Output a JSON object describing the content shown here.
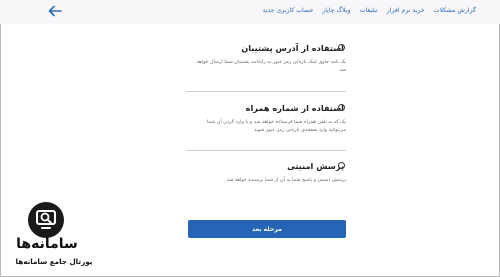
{
  "nav": {
    "items": [
      {
        "label": "گزارش مشکلات"
      },
      {
        "label": "خرید نرم افزار"
      },
      {
        "label": "تبلیغات"
      },
      {
        "label": "وبلاگ چاپار"
      },
      {
        "label": "حساب کاربری جدید"
      }
    ],
    "back_icon": "arrow-left-icon"
  },
  "options": [
    {
      "title": "استفاده از آدرس پشتیبان",
      "description": "یک نامه حاوی لینک بازیابی رمز عبور به رایانامه پشتیبان شما ارسال خواهد شد"
    },
    {
      "title": "استفاده از شماره همراه",
      "description": "یک کد به تلفن همراه شما فرستاده خواهد شد و با وارد کردن آن شما می‌توانید وارد صفحه‌ی بازیابی رمز عبور شوید"
    },
    {
      "title": "پرسش امنیتی",
      "description": "پرسش امنیتی و پاسخ شما به آن از شما پرسیده خواهد شد"
    }
  ],
  "next_button": {
    "label": "مرحله بعد"
  },
  "watermark": {
    "name": "سامانه‌ها",
    "tagline": "پورتال جامع سامانه‌ها",
    "icon": "search-monitor-icon"
  },
  "colors": {
    "link": "#2a6bb5",
    "button": "#2665b6",
    "text": "#1f1f1f",
    "muted": "#666666"
  }
}
